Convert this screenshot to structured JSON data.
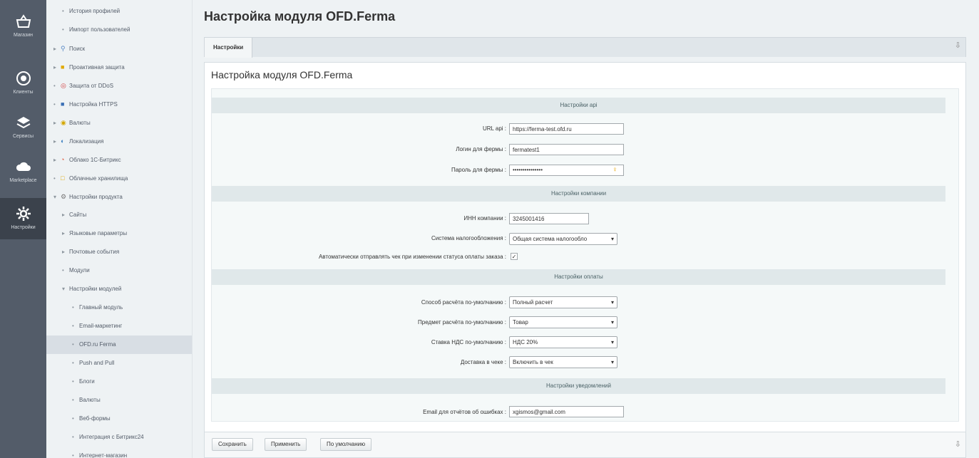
{
  "leftbar": {
    "items": [
      {
        "label": "Магазин",
        "icon": "basket-icon"
      },
      {
        "label": "Клиенты",
        "icon": "clients-icon"
      },
      {
        "label": "Сервисы",
        "icon": "layers-icon"
      },
      {
        "label": "Marketplace",
        "icon": "cloud-icon"
      },
      {
        "label": "Настройки",
        "icon": "gear-icon"
      }
    ]
  },
  "tree": {
    "items": [
      {
        "label": "История профилей",
        "marker": "•"
      },
      {
        "label": "Импорт пользователей",
        "marker": "•"
      },
      {
        "label": "Поиск",
        "marker": "▸",
        "icon": "🔍"
      },
      {
        "label": "Проактивная защита",
        "marker": "▸",
        "icon": "🔒"
      },
      {
        "label": "Защита от DDoS",
        "marker": "•",
        "icon": "⊘"
      },
      {
        "label": "Настройка HTTPS",
        "marker": "•",
        "icon": "🔒"
      },
      {
        "label": "Валюты",
        "marker": "▸",
        "icon": "$"
      },
      {
        "label": "Локализация",
        "marker": "▸",
        "icon": "◐"
      },
      {
        "label": "Облако 1С-Битрикс",
        "marker": "▸",
        "icon": "☁"
      },
      {
        "label": "Облачные хранилища",
        "marker": "•",
        "icon": "▭"
      },
      {
        "label": "Настройки продукта",
        "marker": "▾",
        "icon": "⚙"
      },
      {
        "label": "Сайты",
        "marker": "▸"
      },
      {
        "label": "Языковые параметры",
        "marker": "▸"
      },
      {
        "label": "Почтовые события",
        "marker": "▸"
      },
      {
        "label": "Модули",
        "marker": "•"
      },
      {
        "label": "Настройки модулей",
        "marker": "▾"
      },
      {
        "label": "Главный модуль",
        "marker": "•"
      },
      {
        "label": "Email-маркетинг",
        "marker": "•"
      },
      {
        "label": "OFD.ru Ferma",
        "marker": "•",
        "selected": true
      },
      {
        "label": "Push and Pull",
        "marker": "•"
      },
      {
        "label": "Блоги",
        "marker": "•"
      },
      {
        "label": "Валюты",
        "marker": "•"
      },
      {
        "label": "Веб-формы",
        "marker": "•"
      },
      {
        "label": "Интеграция с Битрикс24",
        "marker": "•"
      },
      {
        "label": "Интернет-магазин",
        "marker": "•"
      }
    ]
  },
  "page": {
    "title": "Настройка модуля OFD.Ferma",
    "tab": "Настройки",
    "content_title": "Настройка модуля OFD.Ferma"
  },
  "sections": {
    "api": "Настройки api",
    "company": "Настройки компании",
    "payment": "Настройки оплаты",
    "notify": "Настройки уведомлений"
  },
  "fields": {
    "url_api": {
      "label": "URL api :",
      "value": "https://ferma-test.ofd.ru"
    },
    "login": {
      "label": "Логин для фермы :",
      "value": "fermatest1"
    },
    "password": {
      "label": "Пароль для фермы :",
      "value": "•••••••••••••••"
    },
    "inn": {
      "label": "ИНН компании :",
      "value": "3245001416"
    },
    "tax": {
      "label": "Система налогообложения :",
      "value": "Общая система налогообло"
    },
    "auto_send": {
      "label": "Автоматически отправлять чек при изменении статуса оплаты заказа :",
      "checked": true
    },
    "calc_method": {
      "label": "Способ расчёта по-умолчанию :",
      "value": "Полный расчет"
    },
    "calc_subject": {
      "label": "Предмет расчёта по-умолчанию :",
      "value": "Товар"
    },
    "vat": {
      "label": "Ставка НДС по-умолчанию :",
      "value": "НДС 20%"
    },
    "delivery": {
      "label": "Доставка в чеке :",
      "value": "Включить в чек"
    },
    "email": {
      "label": "Email для отчётов об ошибках :",
      "value": "xgismos@gmail.com"
    }
  },
  "footer": {
    "save": "Сохранить",
    "apply": "Применить",
    "default": "По умолчанию"
  }
}
